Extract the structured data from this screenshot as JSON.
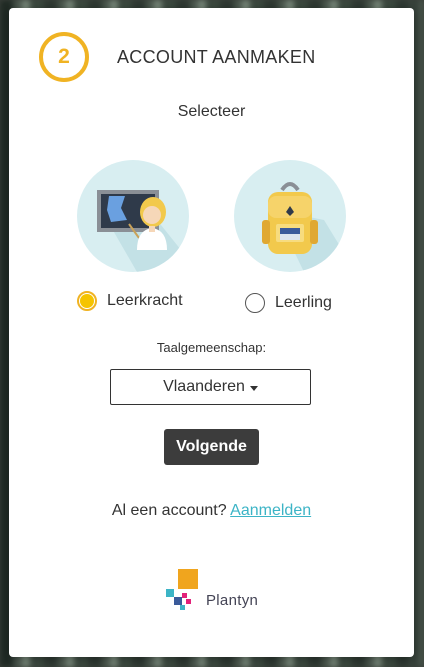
{
  "header": {
    "step_number": "2",
    "title": "ACCOUNT AANMAKEN"
  },
  "selection": {
    "prompt": "Selecteer",
    "roles": [
      {
        "label": "Leerkracht",
        "checked": true,
        "icon": "teacher-icon"
      },
      {
        "label": "Leerling",
        "checked": false,
        "icon": "backpack-icon"
      }
    ]
  },
  "language": {
    "label": "Taalgemeenschap:",
    "selected": "Vlaanderen"
  },
  "actions": {
    "next_label": "Volgende"
  },
  "login": {
    "prompt": "Al een account?",
    "link_label": "Aanmelden"
  },
  "brand": {
    "name": "Plantyn",
    "logo_icon": "plantyn-logo-icon"
  },
  "colors": {
    "accent": "#f0b323",
    "link": "#3cb4c6",
    "button": "#3c3c3c",
    "icon_circle": "#d8eef1"
  }
}
